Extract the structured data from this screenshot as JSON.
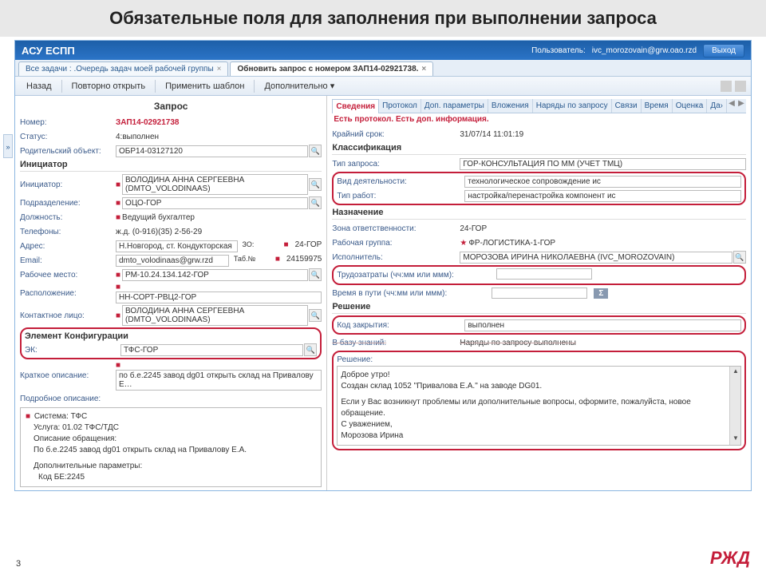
{
  "slide": {
    "title": "Обязательные поля для заполнения при выполнении запроса",
    "num": "3",
    "logo": "РЖД"
  },
  "app": {
    "title": "АСУ ЕСПП",
    "user_prefix": "Пользователь:",
    "user": "ivc_morozovain@grw.oao.rzd",
    "exit": "Выход"
  },
  "maintabs": {
    "t1": "Все задачи : .Очередь задач моей рабочей группы",
    "t2": "Обновить запрос с номером ЗАП14-02921738."
  },
  "toolbar": {
    "back": "Назад",
    "reopen": "Повторно открыть",
    "template": "Применить шаблон",
    "more": "Дополнительно ▾"
  },
  "left": {
    "title": "Запрос",
    "num_l": "Номер:",
    "num_v": "ЗАП14-02921738",
    "status_l": "Статус:",
    "status_v": "4:выполнен",
    "parent_l": "Родительский объект:",
    "parent_v": "ОБР14-03127120",
    "init_h": "Инициатор",
    "init_l": "Инициатор:",
    "init_v": "ВОЛОДИНА АННА СЕРГЕЕВНА (DMTO_VOLODINAAS)",
    "dept_l": "Подразделение:",
    "dept_v": "ОЦО-ГОР",
    "pos_l": "Должность:",
    "pos_v": "Ведущий бухгалтер",
    "phone_l": "Телефоны:",
    "phone_v": "ж.д. (0-916)(35) 2-56-29",
    "addr_l": "Адрес:",
    "addr_v": "Н.Новгород, ст. Кондукторская",
    "zo_l": "ЗО:",
    "zo_v": "24-ГОР",
    "email_l": "Email:",
    "email_v": "dmto_volodinaas@grw.rzd",
    "tab_l": "Таб.№",
    "tab_v": "24159975",
    "wp_l": "Рабочее место:",
    "wp_v": "РМ-10.24.134.142-ГОР",
    "loc_l": "Расположение:",
    "loc_v": "НН-СОРТ-РВЦ2-ГОР",
    "contact_l": "Контактное лицо:",
    "contact_v": "ВОЛОДИНА АННА СЕРГЕЕВНА (DMTO_VOLODINAAS)",
    "ek_h": "Элемент Конфигурации",
    "ek_l": "ЭК:",
    "ek_v": "ТФС-ГОР",
    "short_l": "Краткое описание:",
    "short_v": "по б.е.2245 завод dg01 открыть склад  на Привалову Е…",
    "full_l": "Подробное описание:",
    "d1": "Система: ТФС",
    "d2": "Услуга: 01.02 ТФС/ТДС",
    "d3": "Описание обращения:",
    "d4": "По б.е.2245 завод dg01 открыть склад  на Привалову Е.А.",
    "d5": "Дополнительные параметры:",
    "d6": "Код БЕ:2245"
  },
  "rtabs": {
    "t1": "Сведения",
    "t2": "Протокол",
    "t3": "Доп. параметры",
    "t4": "Вложения",
    "t5": "Наряды по запросу",
    "t6": "Связи",
    "t7": "Время",
    "t8": "Оценка",
    "t9": "Да›"
  },
  "right": {
    "notice": "Есть протокол. Есть доп. информация.",
    "deadline_l": "Крайний срок:",
    "deadline_v": "31/07/14 11:01:19",
    "class_h": "Классификация",
    "rtype_l": "Тип запроса:",
    "rtype_v": "ГОР-КОНСУЛЬТАЦИЯ ПО ММ (УЧЕТ ТМЦ)",
    "act_l": "Вид деятельности:",
    "act_v": "технологическое сопровождение ис",
    "work_l": "Тип работ:",
    "work_v": "настройка/перенастройка компонент ис",
    "assign_h": "Назначение",
    "zone_l": "Зона ответственности:",
    "zone_v": "24-ГОР",
    "group_l": "Рабочая группа:",
    "group_v": "ФР-ЛОГИСТИКА-1-ГОР",
    "exec_l": "Исполнитель:",
    "exec_v": "МОРОЗОВА ИРИНА НИКОЛАЕВНА (IVC_MOROZOVAIN)",
    "labor_l": "Трудозатраты (чч:мм или ммм):",
    "travel_l": "Время в пути (чч:мм или ммм):",
    "sigma": "Σ",
    "sol_h": "Решение",
    "close_l": "Код закрытия:",
    "close_v": "выполнен",
    "kb_l": "В базу знаний:",
    "kb_v": "Наряды по запросу выполнены",
    "sol_l": "Решение:",
    "s1": "Доброе утро!",
    "s2": "Создан склад 1052 \"Привалова Е.А.\" на заводе DG01.",
    "s3": "Если у Вас возникнут проблемы или дополнительные вопросы, оформите, пожалуйста, новое обращение.",
    "s4": "С уважением,",
    "s5": "Морозова Ирина"
  }
}
